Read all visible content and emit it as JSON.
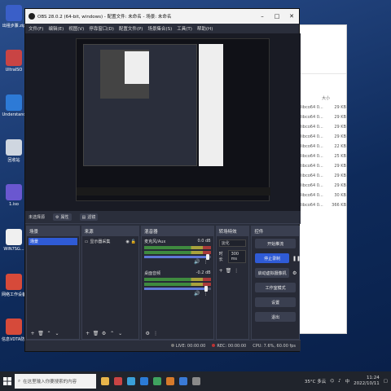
{
  "desktop": {
    "icons": [
      {
        "label": "出租步骤.zip",
        "color": "#3a5fc8"
      },
      {
        "label": "UltraISO",
        "color": "#c94444"
      },
      {
        "label": "Understand",
        "color": "#2d7ad6"
      },
      {
        "label": "回收站",
        "color": "#cfd6e0"
      },
      {
        "label": "1.iso",
        "color": "#6a57d0"
      },
      {
        "label": "WIN7SG...",
        "color": "#f0f0f0"
      },
      {
        "label": "网络工作设备故障处理",
        "color": "#d64a3a"
      },
      {
        "label": "信息VDTA防范理",
        "color": "#d64a3a"
      }
    ]
  },
  "explorer": {
    "column_header": "大小",
    "rows": [
      {
        "name": "libco64 0...",
        "size": "29 KB"
      },
      {
        "name": "libco64 0...",
        "size": "29 KB"
      },
      {
        "name": "libco64 0...",
        "size": "29 KB"
      },
      {
        "name": "libco64 0...",
        "size": "29 KB"
      },
      {
        "name": "libco64 0...",
        "size": "22 KB"
      },
      {
        "name": "libco64 0...",
        "size": "25 KB"
      },
      {
        "name": "libco64 0...",
        "size": "29 KB"
      },
      {
        "name": "libco64 0...",
        "size": "29 KB"
      },
      {
        "name": "libco64 0...",
        "size": "29 KB"
      },
      {
        "name": "libco64 0...",
        "size": "30 KB"
      },
      {
        "name": "libco64 0...",
        "size": "366 KB"
      }
    ]
  },
  "obs": {
    "title": "OBS 28.0.2 (64-bit, windows) - 配置文件: 未命名 - 场景: 未命名",
    "menu": [
      "文件(F)",
      "编辑(E)",
      "视图(V)",
      "停靠窗口(D)",
      "配置文件(P)",
      "场景集合(S)",
      "工具(T)",
      "帮助(H)"
    ],
    "scene_bar": {
      "label": "未选择源",
      "properties": "属性",
      "filters": "滤镜"
    },
    "scenes": {
      "title": "场景",
      "selected": "场景"
    },
    "sources": {
      "title": "来源",
      "items": [
        {
          "name": "显示器采集"
        }
      ]
    },
    "mixer": {
      "title": "混音器",
      "channels": [
        {
          "name": "麦克风/Aux",
          "db": "0.0 dB",
          "level": 0.95
        },
        {
          "name": "桌面音频",
          "db": "-0.2 dB",
          "level": 0.93
        }
      ]
    },
    "transitions": {
      "title": "转场特效",
      "selected": "淡化",
      "duration_label": "时长",
      "duration_value": "300 ms"
    },
    "controls": {
      "title": "控件",
      "buttons": [
        "开始推流",
        "停止录制",
        "启动虚拟摄像机",
        "工作室模式",
        "设置",
        "退出"
      ],
      "active_index": 1
    },
    "status": {
      "live": "LIVE: 00:00:00",
      "rec": "REC: 00:00:00",
      "cpu": "CPU: 7.6%, 60.00 fps"
    }
  },
  "taskbar": {
    "search_placeholder": "在这里输入你要搜索的内容",
    "apps": [
      "#e8b54a",
      "#c94444",
      "#3aa0d8",
      "#2b7bd6",
      "#3fa35f",
      "#d67a2b",
      "#3a7ad6",
      "#8a8a8a"
    ],
    "weather": "35°C 多云",
    "ime": "中",
    "time": "11:24",
    "date": "2022/10/11"
  }
}
